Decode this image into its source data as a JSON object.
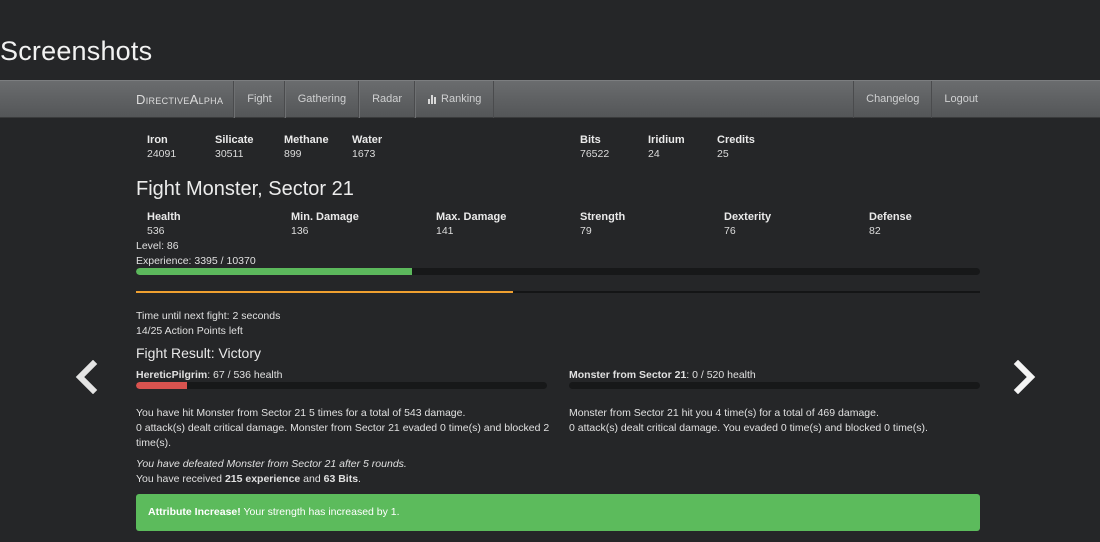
{
  "page_title": "Screenshots",
  "nav": {
    "brand": "DirectiveAlpha",
    "left_items": [
      "Fight",
      "Gathering",
      "Radar",
      "Ranking"
    ],
    "right_items": [
      "Changelog",
      "Logout"
    ]
  },
  "resources": [
    {
      "label": "Iron",
      "value": "24091"
    },
    {
      "label": "Silicate",
      "value": "30511"
    },
    {
      "label": "Methane",
      "value": "899"
    },
    {
      "label": "Water",
      "value": "1673"
    },
    {
      "label": "Bits",
      "value": "76522"
    },
    {
      "label": "Iridium",
      "value": "24"
    },
    {
      "label": "Credits",
      "value": "25"
    }
  ],
  "fight": {
    "title": "Fight Monster, Sector 21",
    "stats": [
      {
        "label": "Health",
        "value": "536"
      },
      {
        "label": "Min. Damage",
        "value": "136"
      },
      {
        "label": "Max. Damage",
        "value": "141"
      },
      {
        "label": "Strength",
        "value": "79"
      },
      {
        "label": "Dexterity",
        "value": "76"
      },
      {
        "label": "Defense",
        "value": "82"
      }
    ],
    "level": "Level: 86",
    "experience_text": "Experience: 3395 / 10370",
    "experience_fraction": 0.3274,
    "cooldown_fraction": 0.447,
    "time_until": "Time until next fight: 2 seconds",
    "action_points": "14/25 Action Points left"
  },
  "result": {
    "title": "Fight Result: Victory",
    "player": {
      "name": "HereticPilgrim",
      "health_text": ": 67 / 536 health",
      "health_fraction": 0.125
    },
    "monster": {
      "name": "Monster from Sector 21",
      "health_text": ": 0 / 520 health",
      "health_fraction": 0
    },
    "player_log_1": "You have hit Monster from Sector 21 5 times for a total of 543 damage.",
    "player_log_2": "0 attack(s) dealt critical damage. Monster from Sector 21 evaded 0 time(s) and blocked 2 time(s).",
    "monster_log_1": "Monster from Sector 21 hit you 4 time(s) for a total of 469 damage.",
    "monster_log_2": "0 attack(s) dealt critical damage. You evaded 0 time(s) and blocked 0 time(s).",
    "defeat_text": "You have defeated Monster from Sector 21 after 5 rounds.",
    "reward_prefix": "You have received ",
    "reward_exp": "215 experience",
    "reward_mid": " and ",
    "reward_bits": "63 Bits",
    "reward_suffix": "."
  },
  "alert": {
    "title": "Attribute Increase!",
    "text": " Your strength has increased by 1."
  },
  "colors": {
    "exp_bar": "#5cb85c",
    "cooldown_bar": "#f0a030",
    "health_bar": "#d9534f",
    "alert_bg": "#5cbb5c"
  }
}
